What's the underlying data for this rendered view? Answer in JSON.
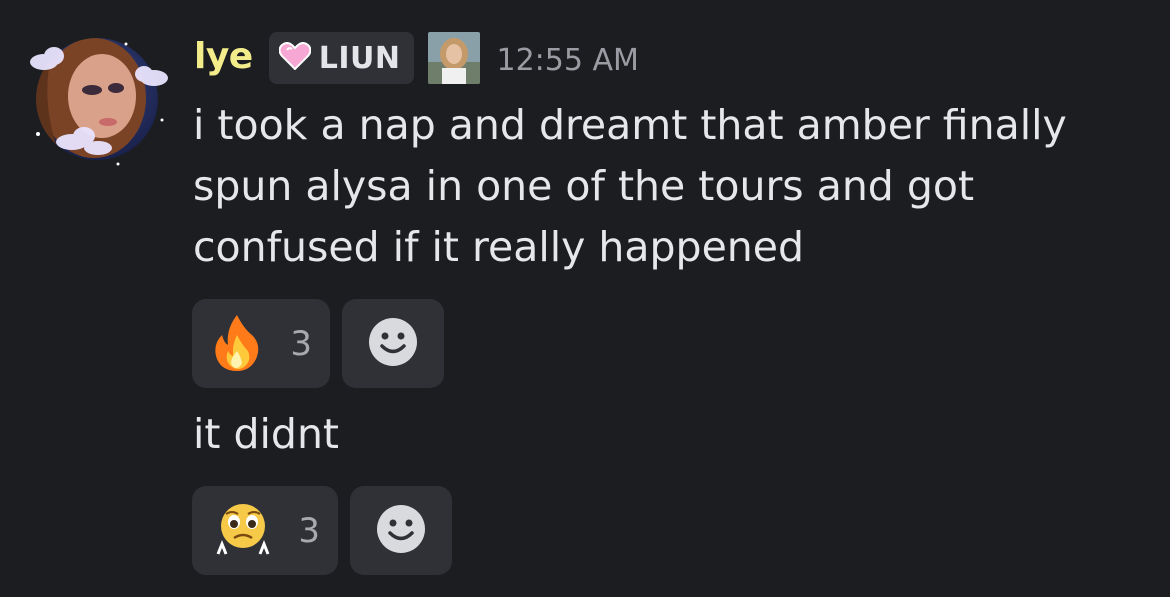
{
  "message": {
    "author": {
      "name": "lye",
      "name_color": "#f2ec8b",
      "role_tag": "LIUN",
      "role_icon": "heart-icon"
    },
    "timestamp": "12:55 AM",
    "text_1": "i took a nap and dreamt that amber finally spun alysa in one of the tours and got confused if it really happened",
    "reactions_1": [
      {
        "emoji": "fire-emoji",
        "count": "3"
      }
    ],
    "text_2": "it didnt",
    "reactions_2": [
      {
        "emoji": "pleading-face-emoji",
        "count": "3"
      }
    ],
    "add_reaction_icon": "smiley-icon"
  },
  "colors": {
    "background": "#1c1d21",
    "pill": "#2f3136",
    "text": "#e6e7ea",
    "muted": "#9b9ca3"
  }
}
